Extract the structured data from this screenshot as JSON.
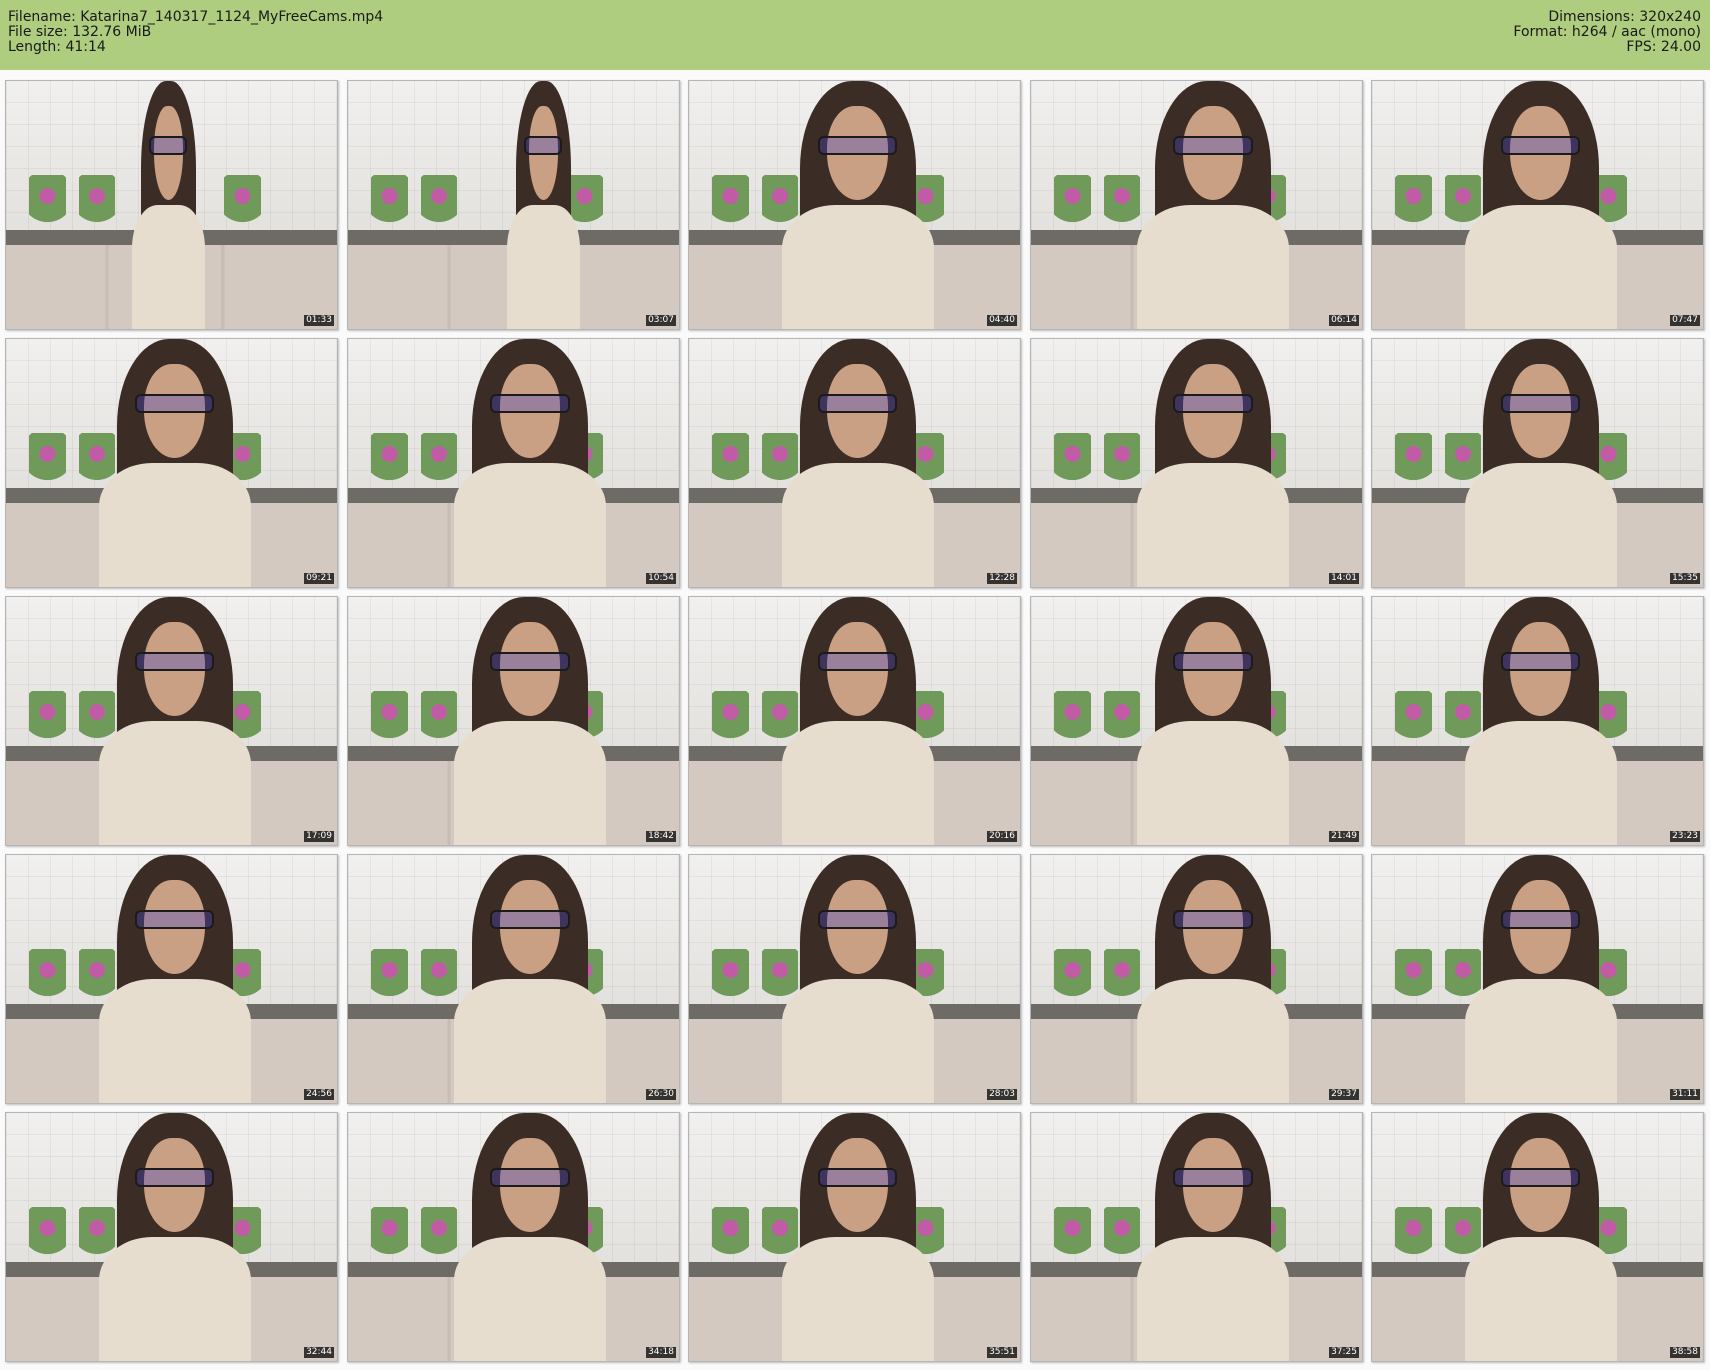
{
  "header": {
    "filename": "Filename: Katarina7_140317_1124_MyFreeCams.mp4",
    "file_size": "File size: 132.76 MiB",
    "length": "Length: 41:14",
    "dimensions": "Dimensions: 320x240",
    "format": "Format: h264 / aac (mono)",
    "fps": "FPS: 24.00"
  },
  "colors": {
    "header_background": "#aecd7e",
    "timestamp_background": "#000000"
  },
  "thumbnails": [
    {
      "time": "01:33"
    },
    {
      "time": "03:07"
    },
    {
      "time": "04:40"
    },
    {
      "time": "06:14"
    },
    {
      "time": "07:47"
    },
    {
      "time": "09:21"
    },
    {
      "time": "10:54"
    },
    {
      "time": "12:28"
    },
    {
      "time": "14:01"
    },
    {
      "time": "15:35"
    },
    {
      "time": "17:09"
    },
    {
      "time": "18:42"
    },
    {
      "time": "20:16"
    },
    {
      "time": "21:49"
    },
    {
      "time": "23:23"
    },
    {
      "time": "24:56"
    },
    {
      "time": "26:30"
    },
    {
      "time": "28:03"
    },
    {
      "time": "29:37"
    },
    {
      "time": "31:11"
    },
    {
      "time": "32:44"
    },
    {
      "time": "34:18"
    },
    {
      "time": "35:51"
    },
    {
      "time": "37:25"
    },
    {
      "time": "38:58"
    }
  ]
}
